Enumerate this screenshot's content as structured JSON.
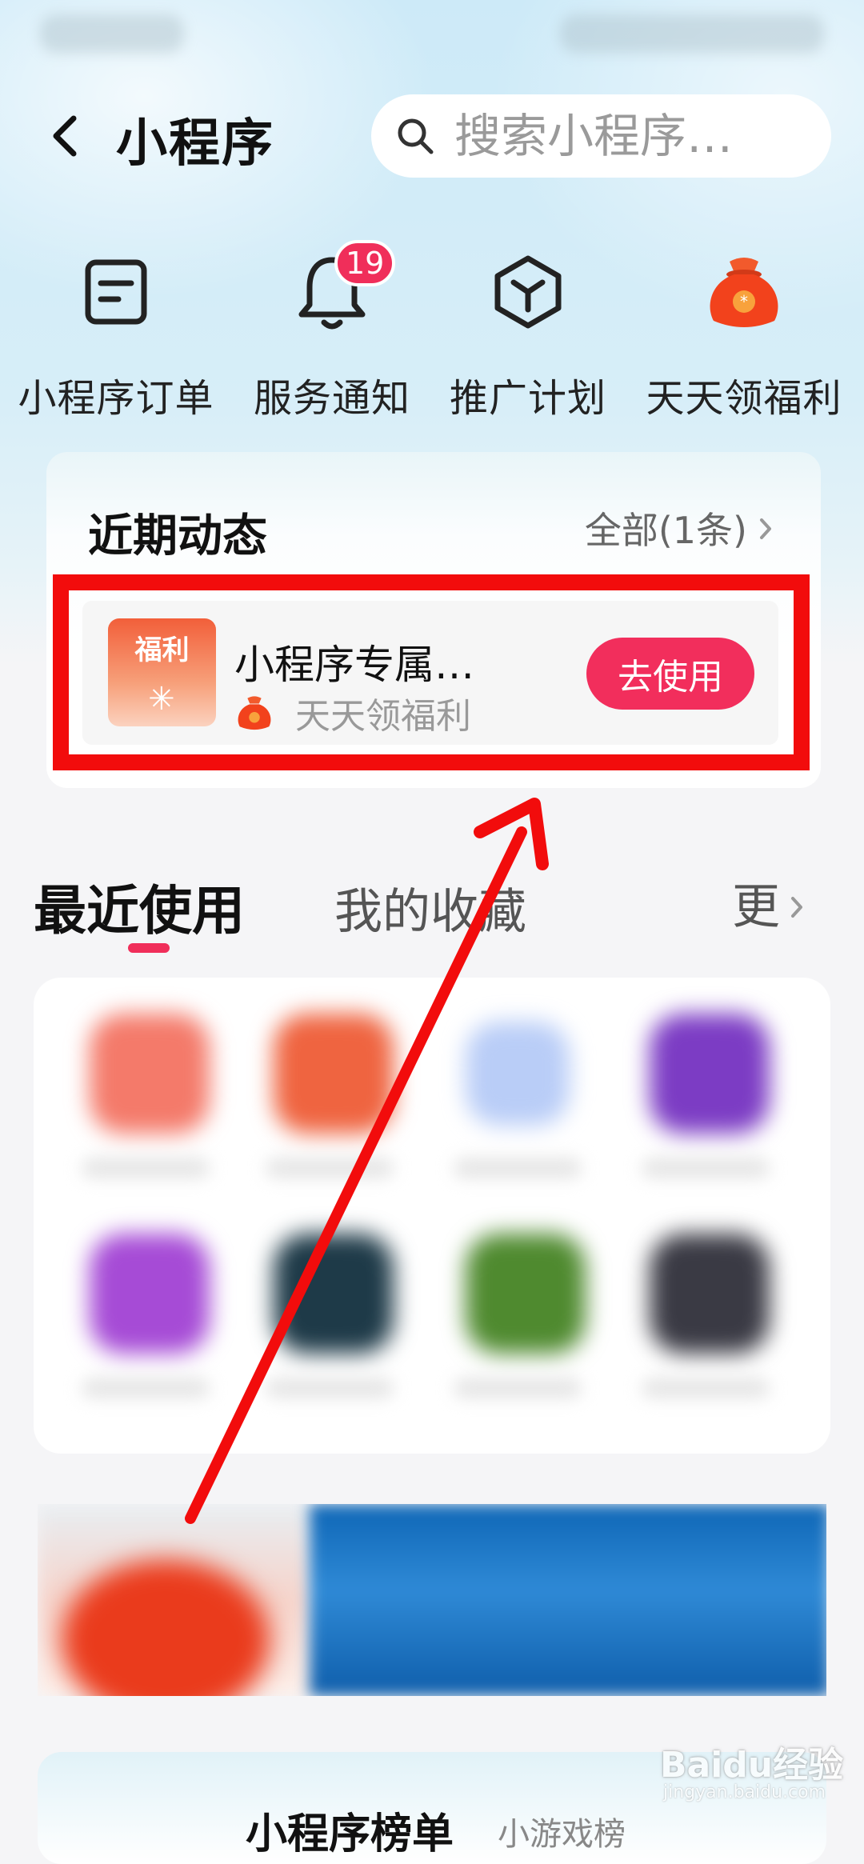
{
  "header": {
    "title": "小程序",
    "search_placeholder": "搜索小程序…"
  },
  "quick_actions": [
    {
      "label": "小程序订单",
      "icon": "order-icon"
    },
    {
      "label": "服务通知",
      "icon": "bell-icon",
      "badge": "19"
    },
    {
      "label": "推广计划",
      "icon": "promotion-cube-icon"
    },
    {
      "label": "天天领福利",
      "icon": "lucky-bag-icon"
    }
  ],
  "recent_activity": {
    "title": "近期动态",
    "all_label": "全部(1条)",
    "item": {
      "thumb_tag": "福利",
      "name": "小程序专属…",
      "source": "天天领福利",
      "button": "去使用"
    }
  },
  "tabs": {
    "active": "最近使用",
    "favorites": "我的收藏",
    "more": "更"
  },
  "ranking": {
    "title": "小程序榜单",
    "subtitle": "小游戏榜"
  },
  "watermark": {
    "logo": "Baidu经验",
    "url": "jingyan.baidu.com"
  },
  "colors": {
    "accent": "#f02e5a",
    "annotation_red": "#f20c0c",
    "hero_bg": "#d7eef8"
  }
}
